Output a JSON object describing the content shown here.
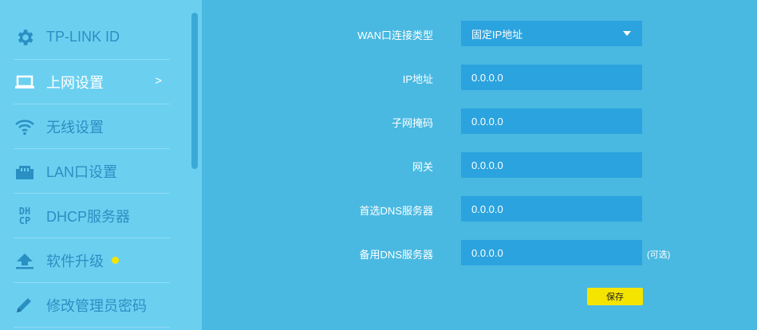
{
  "sidebar": {
    "items": [
      {
        "label": "TP-LINK ID",
        "icon": "gear-icon"
      },
      {
        "label": "上网设置",
        "icon": "laptop-icon",
        "active": true,
        "arrow": ">"
      },
      {
        "label": "无线设置",
        "icon": "wifi-icon"
      },
      {
        "label": "LAN口设置",
        "icon": "lan-port-icon"
      },
      {
        "label": "DHCP服务器",
        "icon": "dhcp-icon",
        "icon_text": [
          "DH",
          "CP"
        ]
      },
      {
        "label": "软件升级",
        "icon": "upload-icon",
        "badge": "yellow-dot"
      },
      {
        "label": "修改管理员密码",
        "icon": "pencil-icon"
      }
    ]
  },
  "form": {
    "wan_type": {
      "label": "WAN口连接类型",
      "value": "固定IP地址"
    },
    "ip": {
      "label": "IP地址",
      "value": "0.0.0.0"
    },
    "mask": {
      "label": "子网掩码",
      "value": "0.0.0.0"
    },
    "gateway": {
      "label": "网关",
      "value": "0.0.0.0"
    },
    "dns1": {
      "label": "首选DNS服务器",
      "value": "0.0.0.0"
    },
    "dns2": {
      "label": "备用DNS服务器",
      "value": "0.0.0.0",
      "note": "(可选)"
    },
    "save_label": "保存"
  },
  "colors": {
    "sidebar_bg": "#6bd0f0",
    "main_bg": "#49b9e1",
    "field_bg": "#2ba3de",
    "accent": "#f5e400",
    "nav_text": "#2a8fc2"
  }
}
